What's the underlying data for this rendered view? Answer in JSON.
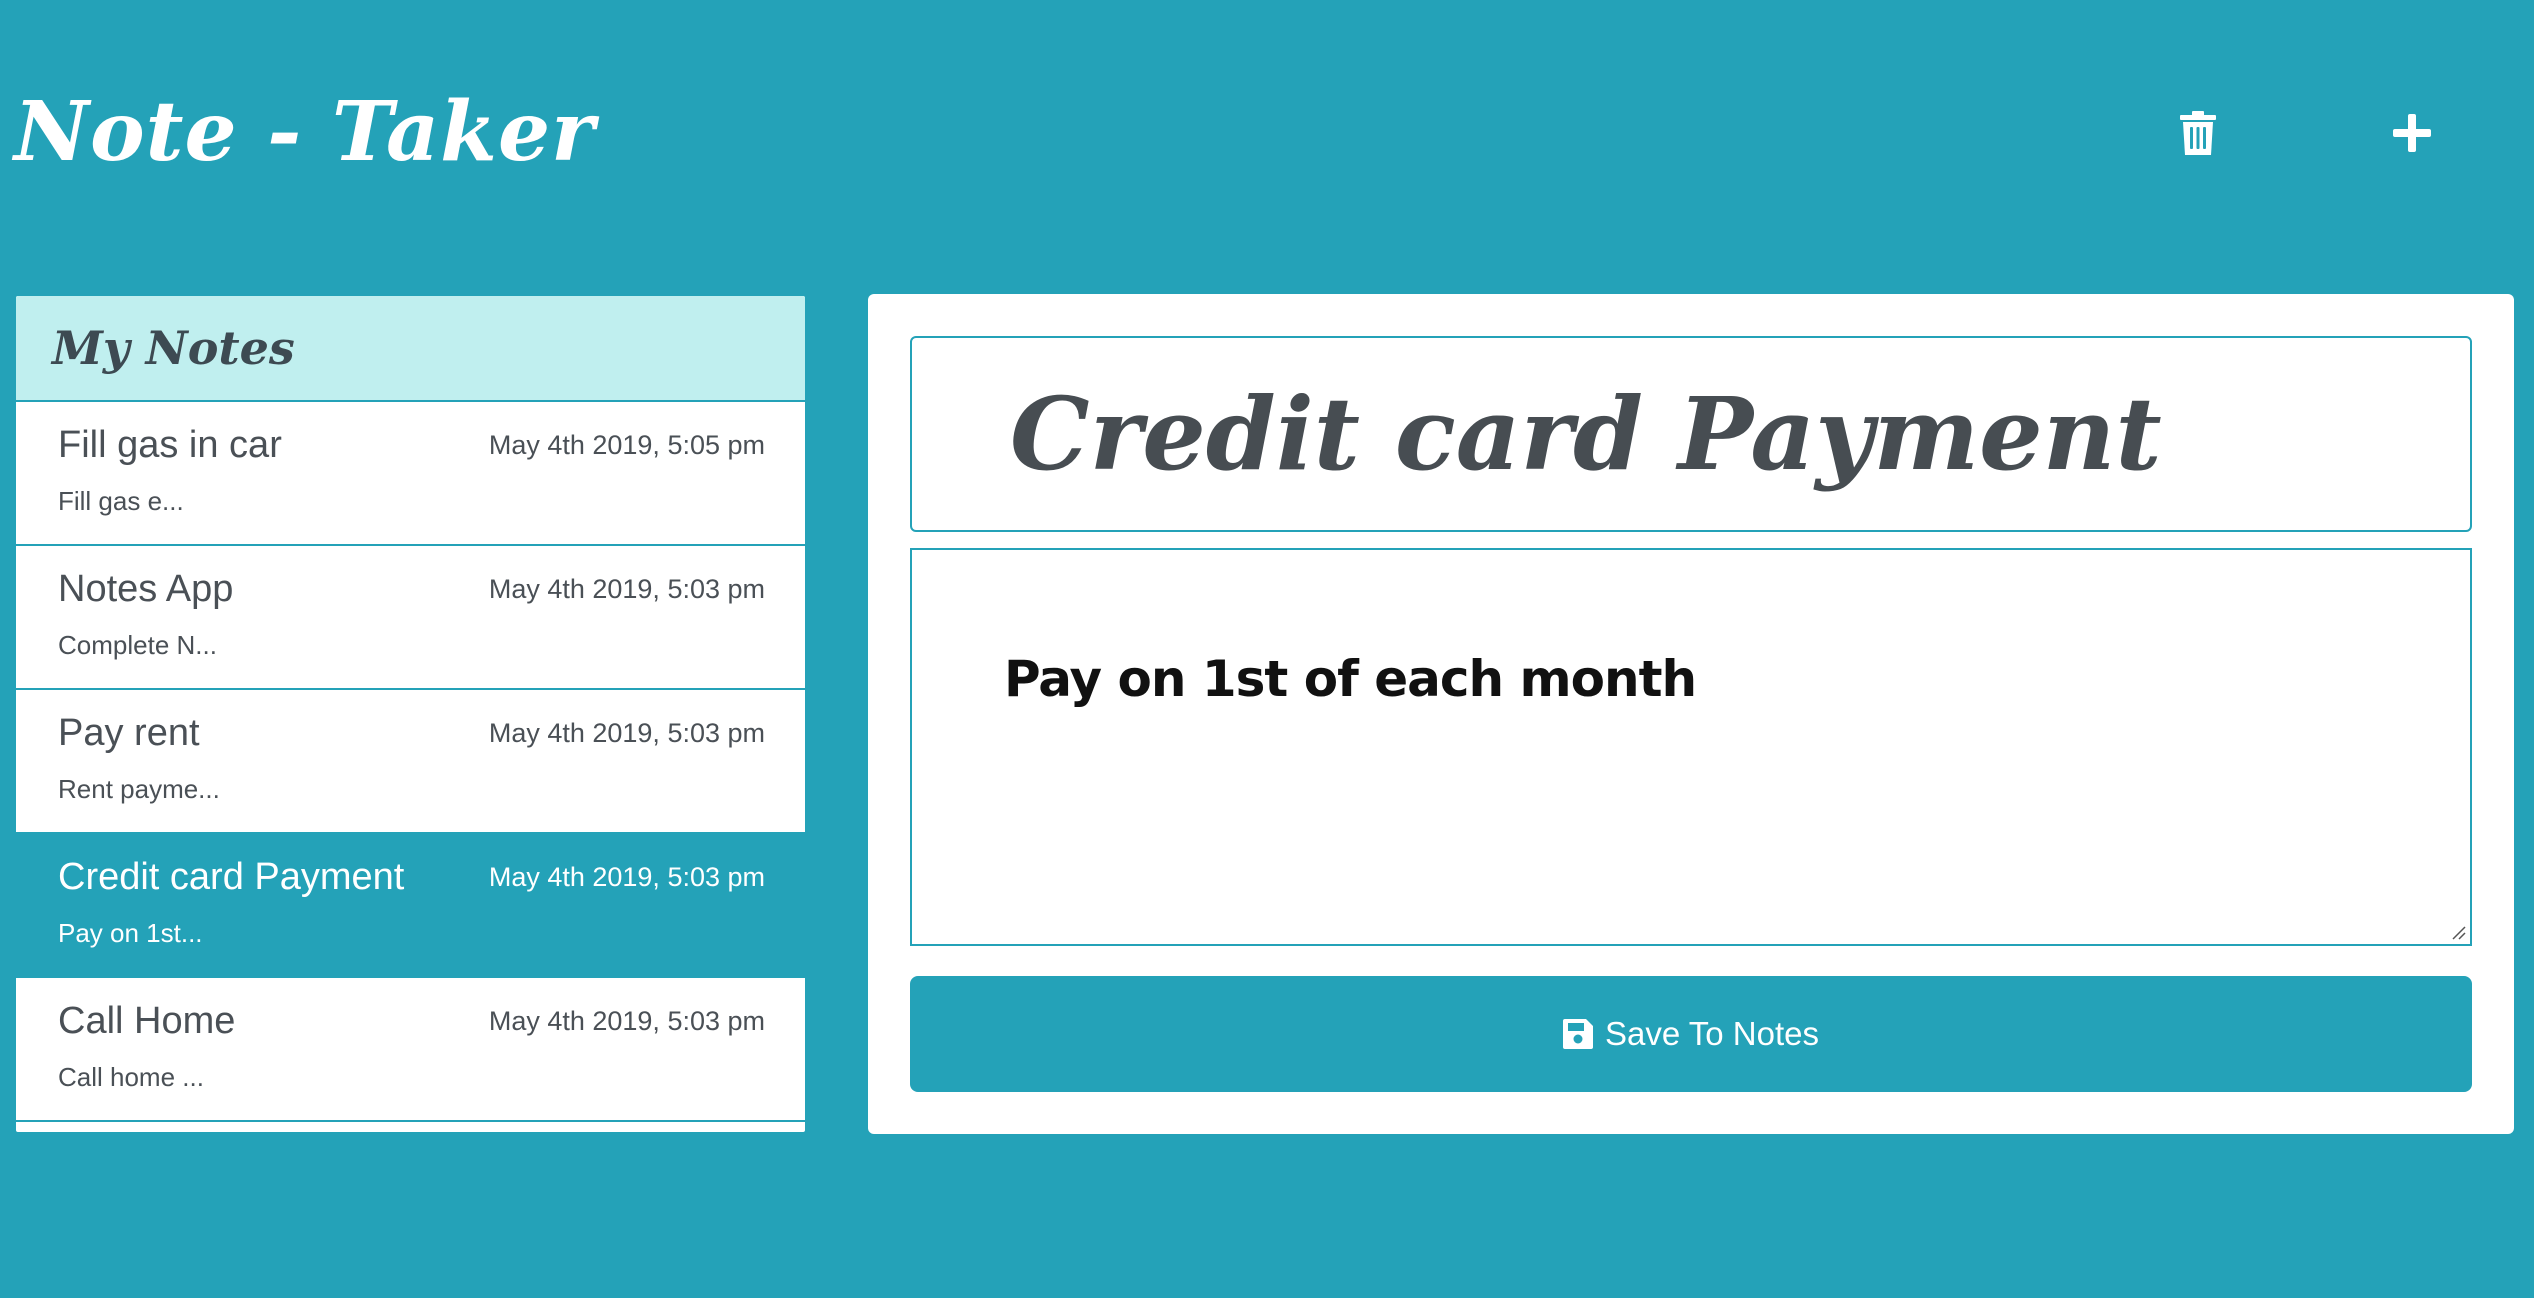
{
  "app": {
    "title": "Note - Taker",
    "background_color": "#24a2b8"
  },
  "header": {
    "delete_icon": "trash-icon",
    "add_icon": "plus-icon"
  },
  "sidebar": {
    "heading": "My Notes",
    "header_color": "#c0efef",
    "notes": [
      {
        "title": "Fill gas in car",
        "date": "May 4th 2019, 5:05 pm",
        "preview": "Fill gas e...",
        "active": false
      },
      {
        "title": "Notes App",
        "date": "May 4th 2019, 5:03 pm",
        "preview": "Complete N...",
        "active": false
      },
      {
        "title": "Pay rent",
        "date": "May 4th 2019, 5:03 pm",
        "preview": "Rent payme...",
        "active": false
      },
      {
        "title": "Credit card Payment",
        "date": "May 4th 2019, 5:03 pm",
        "preview": "Pay on 1st...",
        "active": true
      },
      {
        "title": "Call Home",
        "date": "May 4th 2019, 5:03 pm",
        "preview": "Call home ...",
        "active": false
      }
    ]
  },
  "editor": {
    "note_title": "Credit card Payment",
    "note_text": "Pay on 1st of each month",
    "save_icon": "floppy-disk-icon",
    "save_label": "Save To Notes"
  }
}
